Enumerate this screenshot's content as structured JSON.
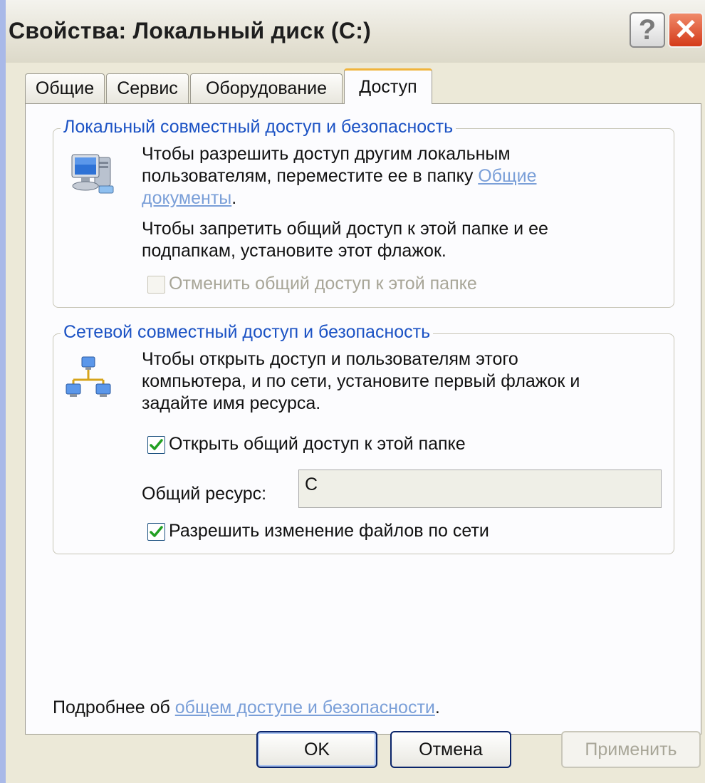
{
  "window": {
    "title": "Свойства: Локальный диск (C:)"
  },
  "titlebar": {
    "help_label": "?",
    "close_label": "✕"
  },
  "tabs": [
    {
      "label": "Общие",
      "active": false
    },
    {
      "label": "Сервис",
      "active": false
    },
    {
      "label": "Оборудование",
      "active": false
    },
    {
      "label": "Доступ",
      "active": true
    }
  ],
  "local_group": {
    "legend": "Локальный совместный доступ и безопасность",
    "icon": "computer-icon",
    "text1_line1": "Чтобы разрешить доступ другим локальным",
    "text1_line2": "пользователям, переместите ее в папку ",
    "link_part1": "Общие",
    "link_part2": "документы",
    "text1_end": ".",
    "text2_line1": "Чтобы запретить общий доступ к этой папке и ее",
    "text2_line2": "подпапкам, установите этот флажок.",
    "checkbox_label": "Отменить общий доступ к этой папке",
    "checkbox_checked": false,
    "checkbox_enabled": false
  },
  "network_group": {
    "legend": "Сетевой совместный доступ и безопасность",
    "icon": "network-icon",
    "text_line1": "Чтобы открыть доступ и пользователям этого",
    "text_line2": "компьютера, и по сети, установите первый флажок и",
    "text_line3": "задайте имя ресурса.",
    "share_checkbox_label": "Открыть общий доступ к этой папке",
    "share_checked": true,
    "resource_label": "Общий ресурс:",
    "resource_value": "C",
    "allow_checkbox_label": "Разрешить изменение файлов по сети",
    "allow_checked": true
  },
  "footer": {
    "more_prefix": "Подробнее об ",
    "more_link": "общем доступе и безопасности",
    "more_suffix": "."
  },
  "buttons": {
    "ok": "OK",
    "cancel": "Отмена",
    "apply": "Применить"
  },
  "colors": {
    "accent": "#f0b43c",
    "legend": "#1b52c4",
    "link": "#7a9fd8",
    "check": "#22a022",
    "close": "#d43a1a"
  }
}
